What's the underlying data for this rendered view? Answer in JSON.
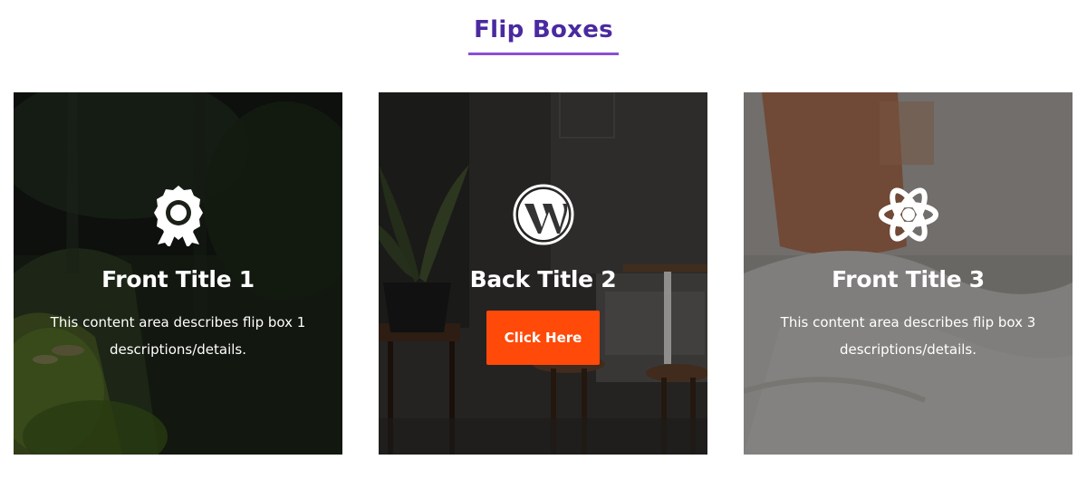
{
  "section": {
    "title": "Flip Boxes",
    "underline_color": "#8a4fd6",
    "title_color": "#4a2aa0"
  },
  "boxes": [
    {
      "icon": "award-ribbon-icon",
      "title": "Front Title 1",
      "description": "This content area describes flip box 1 descriptions/details."
    },
    {
      "icon": "wordpress-icon",
      "title": "Back Title 2",
      "button_label": "Click Here",
      "button_color": "#ff4a0a"
    },
    {
      "icon": "atom-icon",
      "title": "Front Title 3",
      "description": "This content area describes flip box 3 descriptions/details."
    }
  ]
}
